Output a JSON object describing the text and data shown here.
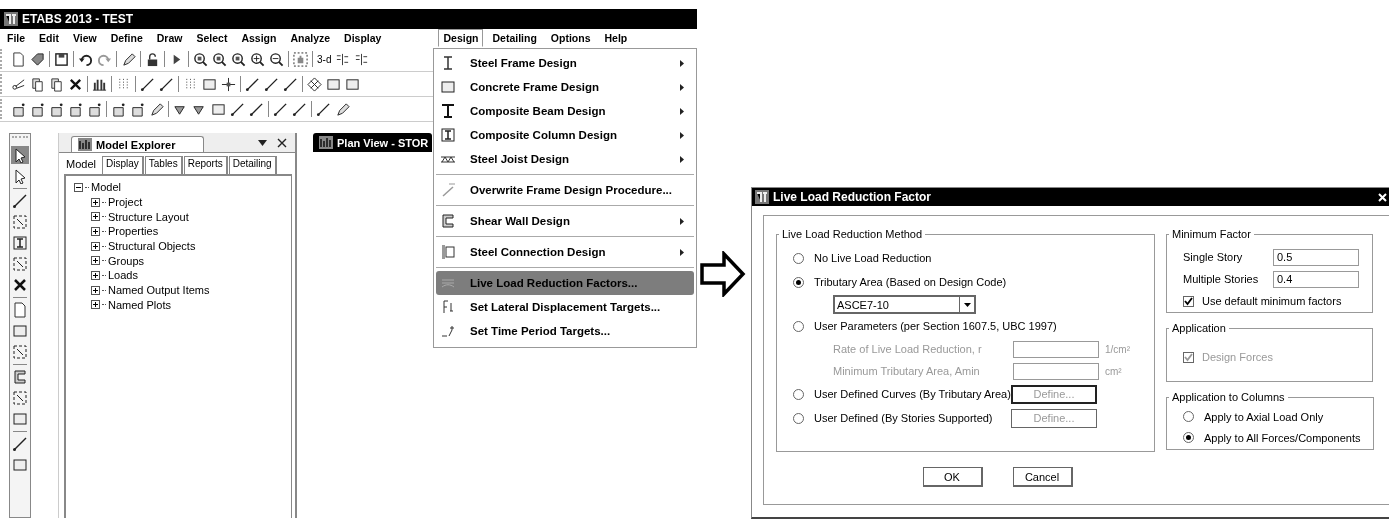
{
  "app": {
    "title": "ETABS 2013 - TEST",
    "menu": [
      {
        "label": "File",
        "selected": false
      },
      {
        "label": "Edit",
        "selected": false
      },
      {
        "label": "View",
        "selected": false
      },
      {
        "label": "Define",
        "selected": false
      },
      {
        "label": "Draw",
        "selected": false
      },
      {
        "label": "Select",
        "selected": false
      },
      {
        "label": "Assign",
        "selected": false
      },
      {
        "label": "Analyze",
        "selected": false
      },
      {
        "label": "Display",
        "selected": false
      },
      {
        "label": "Design",
        "selected": true
      },
      {
        "label": "Detailing",
        "selected": false
      },
      {
        "label": "Options",
        "selected": false
      },
      {
        "label": "Help",
        "selected": false
      }
    ],
    "toolbar_texts": [
      "3-d"
    ],
    "explorer": {
      "title": "Model Explorer",
      "tabs": [
        {
          "label": "Model",
          "selected": true
        },
        {
          "label": "Display",
          "selected": false
        },
        {
          "label": "Tables",
          "selected": false
        },
        {
          "label": "Reports",
          "selected": false
        },
        {
          "label": "Detailing",
          "selected": false
        }
      ],
      "tree": {
        "label": "Model",
        "expanded": true,
        "children": [
          {
            "label": "Project",
            "expanded": false
          },
          {
            "label": "Structure Layout",
            "expanded": false
          },
          {
            "label": "Properties",
            "expanded": false
          },
          {
            "label": "Structural Objects",
            "expanded": false
          },
          {
            "label": "Groups",
            "expanded": false
          },
          {
            "label": "Loads",
            "expanded": false
          },
          {
            "label": "Named Output Items",
            "expanded": false
          },
          {
            "label": "Named Plots",
            "expanded": false
          }
        ]
      }
    },
    "view_tab": {
      "title": "Plan View - STOR"
    },
    "design_menu": [
      [
        {
          "label": "Steel Frame Design",
          "submenu": true,
          "selected": false
        },
        {
          "label": "Concrete Frame Design",
          "submenu": true,
          "selected": false
        },
        {
          "label": "Composite Beam Design",
          "submenu": true,
          "selected": false
        },
        {
          "label": "Composite Column Design",
          "submenu": true,
          "selected": false
        },
        {
          "label": "Steel Joist Design",
          "submenu": true,
          "selected": false
        }
      ],
      [
        {
          "label": "Overwrite Frame Design Procedure...",
          "submenu": false,
          "selected": false
        }
      ],
      [
        {
          "label": "Shear Wall Design",
          "submenu": true,
          "selected": false
        }
      ],
      [
        {
          "label": "Steel Connection Design",
          "submenu": true,
          "selected": false
        }
      ],
      [
        {
          "label": "Live Load Reduction Factors...",
          "submenu": false,
          "selected": true
        },
        {
          "label": "Set Lateral Displacement Targets...",
          "submenu": false,
          "selected": false
        },
        {
          "label": "Set Time Period Targets...",
          "submenu": false,
          "selected": false
        }
      ]
    ]
  },
  "dialog": {
    "title": "Live Load Reduction Factor",
    "method": {
      "legend": "Live Load Reduction Method",
      "options": [
        {
          "label": "No Live Load Reduction",
          "selected": false
        },
        {
          "label": "Tributary Area (Based on Design Code)",
          "selected": true,
          "code": "ASCE7-10"
        },
        {
          "label": "User Parameters (per Section 1607.5, UBC 1997)",
          "selected": false,
          "params": [
            {
              "label": "Rate of Live Load Reduction, r",
              "unit": "1/cm²",
              "disabled": true
            },
            {
              "label": "Minimum Tributary Area, Amin",
              "unit": "cm²",
              "disabled": true
            }
          ]
        },
        {
          "label": "User Defined Curves (By Tributary Area)",
          "selected": false,
          "button": {
            "label": "Define...",
            "disabled": true,
            "focused": true
          }
        },
        {
          "label": "User Defined (By Stories Supported)",
          "selected": false,
          "button": {
            "label": "Define...",
            "disabled": true,
            "focused": false
          }
        }
      ]
    },
    "minimum": {
      "legend": "Minimum Factor",
      "fields": [
        {
          "label": "Single Story",
          "value": "0.5"
        },
        {
          "label": "Multiple Stories",
          "value": "0.4"
        }
      ],
      "checkbox": {
        "label": "Use default minimum factors",
        "checked": true,
        "disabled": false
      }
    },
    "application": {
      "legend": "Application",
      "checkbox": {
        "label": "Design Forces",
        "checked": true,
        "disabled": true
      }
    },
    "columns": {
      "legend": "Application to Columns",
      "options": [
        {
          "label": "Apply to Axial Load Only",
          "selected": false
        },
        {
          "label": "Apply to All Forces/Components",
          "selected": true
        }
      ]
    },
    "buttons": [
      "OK",
      "Cancel"
    ]
  }
}
